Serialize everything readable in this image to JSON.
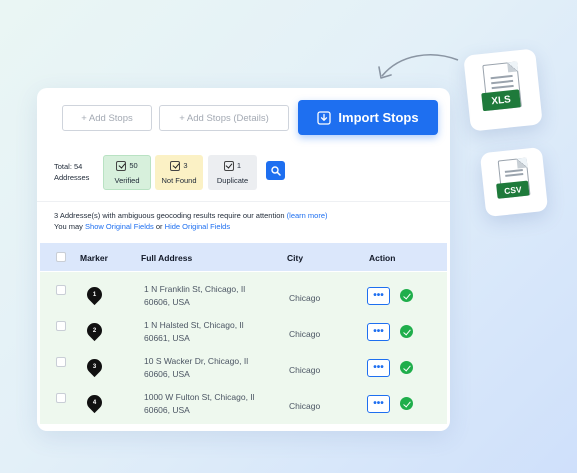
{
  "toolbar": {
    "add_stops_label": "+ Add Stops",
    "add_stops_details_label": "+ Add Stops (Details)",
    "import_stops_label": "Import Stops"
  },
  "summary": {
    "total_line1": "Total: 54",
    "total_line2": "Addresses",
    "verified": {
      "count": "50",
      "label": "Verified",
      "color": "#d7f0dc"
    },
    "not_found": {
      "count": "3",
      "label": "Not Found",
      "color": "#fbf1c5"
    },
    "duplicate": {
      "count": "1",
      "label": "Duplicate",
      "color": "#eceef1"
    }
  },
  "notice": {
    "line1_text": "3 Addresse(s) with ambiguous geocoding results require our attention",
    "line1_link": "(learn more)",
    "line2_prefix": "You may",
    "show_link": "Show Original Fields",
    "or_text": "or",
    "hide_link": "Hide Original Fields"
  },
  "table": {
    "headers": {
      "marker": "Marker",
      "address": "Full Address",
      "city": "City",
      "action": "Action"
    },
    "rows": [
      {
        "marker": "1",
        "address_line1": "1 N Franklin St, Chicago, Il",
        "address_line2": "60606, USA",
        "city": "Chicago"
      },
      {
        "marker": "2",
        "address_line1": "1 N Halsted St, Chicago, Il",
        "address_line2": "60661, USA",
        "city": "Chicago"
      },
      {
        "marker": "3",
        "address_line1": "10 S Wacker Dr, Chicago, Il",
        "address_line2": "60606, USA",
        "city": "Chicago"
      },
      {
        "marker": "4",
        "address_line1": "1000 W Fulton St, Chicago, Il",
        "address_line2": "60606, USA",
        "city": "Chicago"
      }
    ],
    "more_label": "•••"
  },
  "files": {
    "xls_label": "XLS",
    "csv_label": "CSV"
  },
  "colors": {
    "accent": "#1e6ff0",
    "success": "#1fae4b",
    "file_badge": "#1e7a3b"
  }
}
